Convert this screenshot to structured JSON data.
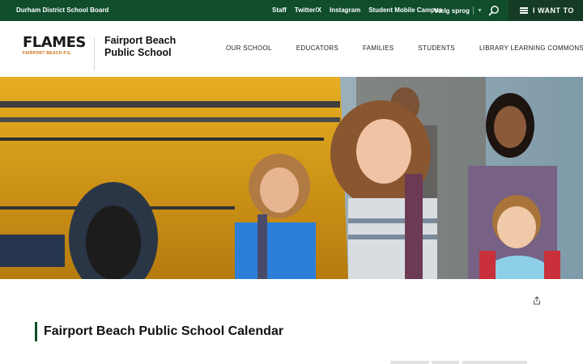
{
  "topbar": {
    "board_name": "Durham District School Board",
    "links": [
      "Staff",
      "Twitter/X",
      "Instagram",
      "Student Mobile Campus"
    ],
    "language": "Vælg sprog",
    "i_want_to": "I WANT TO",
    "colors": {
      "bar": "#0f4d2b",
      "i_want_to_bg": "#163b24"
    }
  },
  "header": {
    "logo": {
      "wordmark": "FLAMES",
      "subtext": "FAIRPORT BEACH P.S."
    },
    "school_name_line1": "Fairport Beach",
    "school_name_line2": "Public School",
    "nav": [
      "OUR SCHOOL",
      "EDUCATORS",
      "FAMILIES",
      "STUDENTS",
      "LIBRARY LEARNING COMMONS"
    ]
  },
  "hero": {
    "image": "students-running-by-school-bus-photo"
  },
  "page": {
    "title": "Fairport Beach Public School Calendar",
    "accent_color": "#0f4d2b"
  },
  "icons": {
    "search": "search-icon",
    "menu": "menu-icon",
    "share": "share-icon"
  }
}
